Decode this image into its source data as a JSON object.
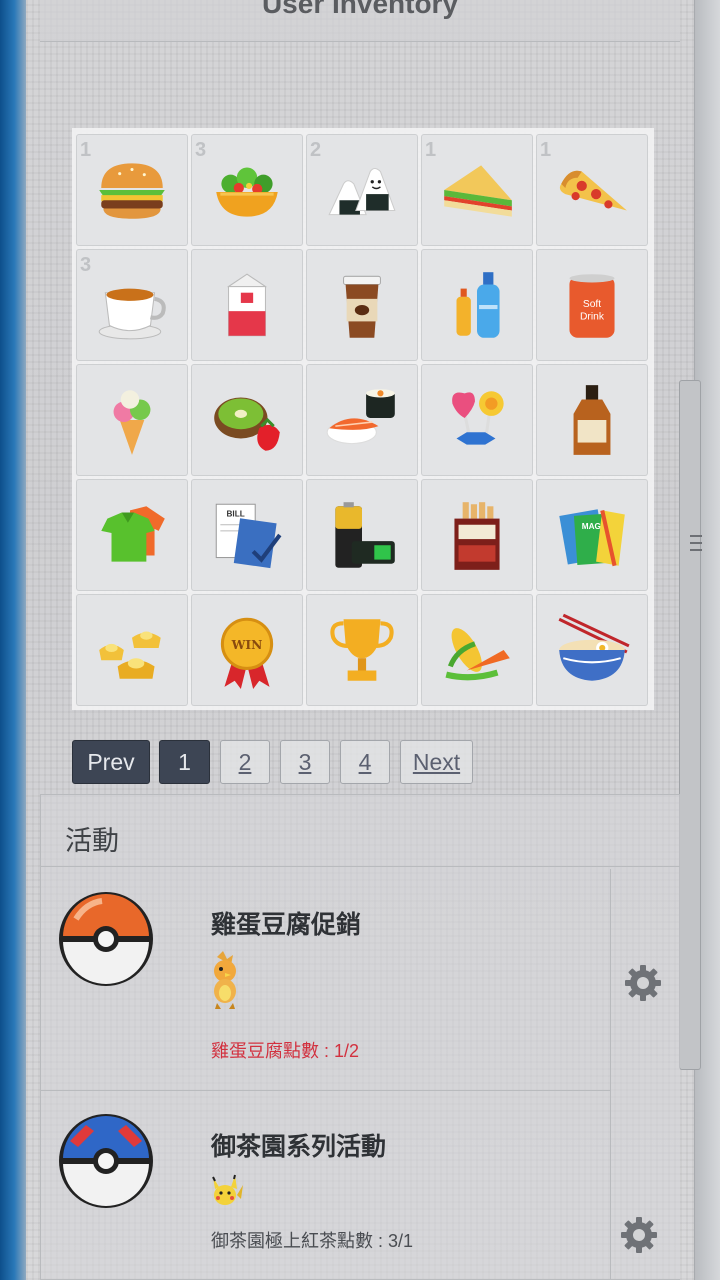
{
  "header": {
    "title": "User Inventory"
  },
  "inventory": {
    "slots": [
      {
        "icon": "hamburger-icon",
        "count": "1"
      },
      {
        "icon": "salad-icon",
        "count": "3"
      },
      {
        "icon": "rice-ball-icon",
        "count": "2"
      },
      {
        "icon": "sandwich-icon",
        "count": "1"
      },
      {
        "icon": "pizza-icon",
        "count": "1"
      },
      {
        "icon": "tea-cup-icon",
        "count": "3"
      },
      {
        "icon": "milk-carton-icon",
        "count": ""
      },
      {
        "icon": "coffee-cup-icon",
        "count": ""
      },
      {
        "icon": "bottles-icon",
        "count": ""
      },
      {
        "icon": "soft-drink-can-icon",
        "count": "",
        "label": "Soft Drink"
      },
      {
        "icon": "ice-cream-icon",
        "count": ""
      },
      {
        "icon": "kiwi-strawberry-icon",
        "count": ""
      },
      {
        "icon": "sushi-icon",
        "count": ""
      },
      {
        "icon": "candy-icon",
        "count": ""
      },
      {
        "icon": "whisky-bottle-icon",
        "count": ""
      },
      {
        "icon": "polo-shirts-icon",
        "count": ""
      },
      {
        "icon": "bill-icon",
        "count": "",
        "label": "BILL"
      },
      {
        "icon": "batteries-icon",
        "count": ""
      },
      {
        "icon": "cigarettes-icon",
        "count": ""
      },
      {
        "icon": "magazines-icon",
        "count": "",
        "label": "MAG"
      },
      {
        "icon": "gold-ingots-icon",
        "count": ""
      },
      {
        "icon": "win-medal-icon",
        "count": "",
        "label": "WIN"
      },
      {
        "icon": "trophy-icon",
        "count": ""
      },
      {
        "icon": "vegetables-icon",
        "count": ""
      },
      {
        "icon": "noodle-bowl-icon",
        "count": ""
      }
    ]
  },
  "pagination": {
    "prev": "Prev",
    "pages": [
      "1",
      "2",
      "3",
      "4"
    ],
    "current": "1",
    "next": "Next"
  },
  "activity": {
    "title": "活動",
    "events": [
      {
        "name": "雞蛋豆腐促銷",
        "ball": "poke-ball-icon",
        "sprite": "torchic-sprite-icon",
        "points": "雞蛋豆腐點數 : 1/2",
        "points_color": "#d2313f"
      },
      {
        "name": "御茶園系列活動",
        "ball": "great-ball-icon",
        "sprite": "pikachu-sprite-icon",
        "points": "御茶園極上紅茶點數 : 3/1",
        "points_color": "#4a4d52"
      }
    ]
  }
}
